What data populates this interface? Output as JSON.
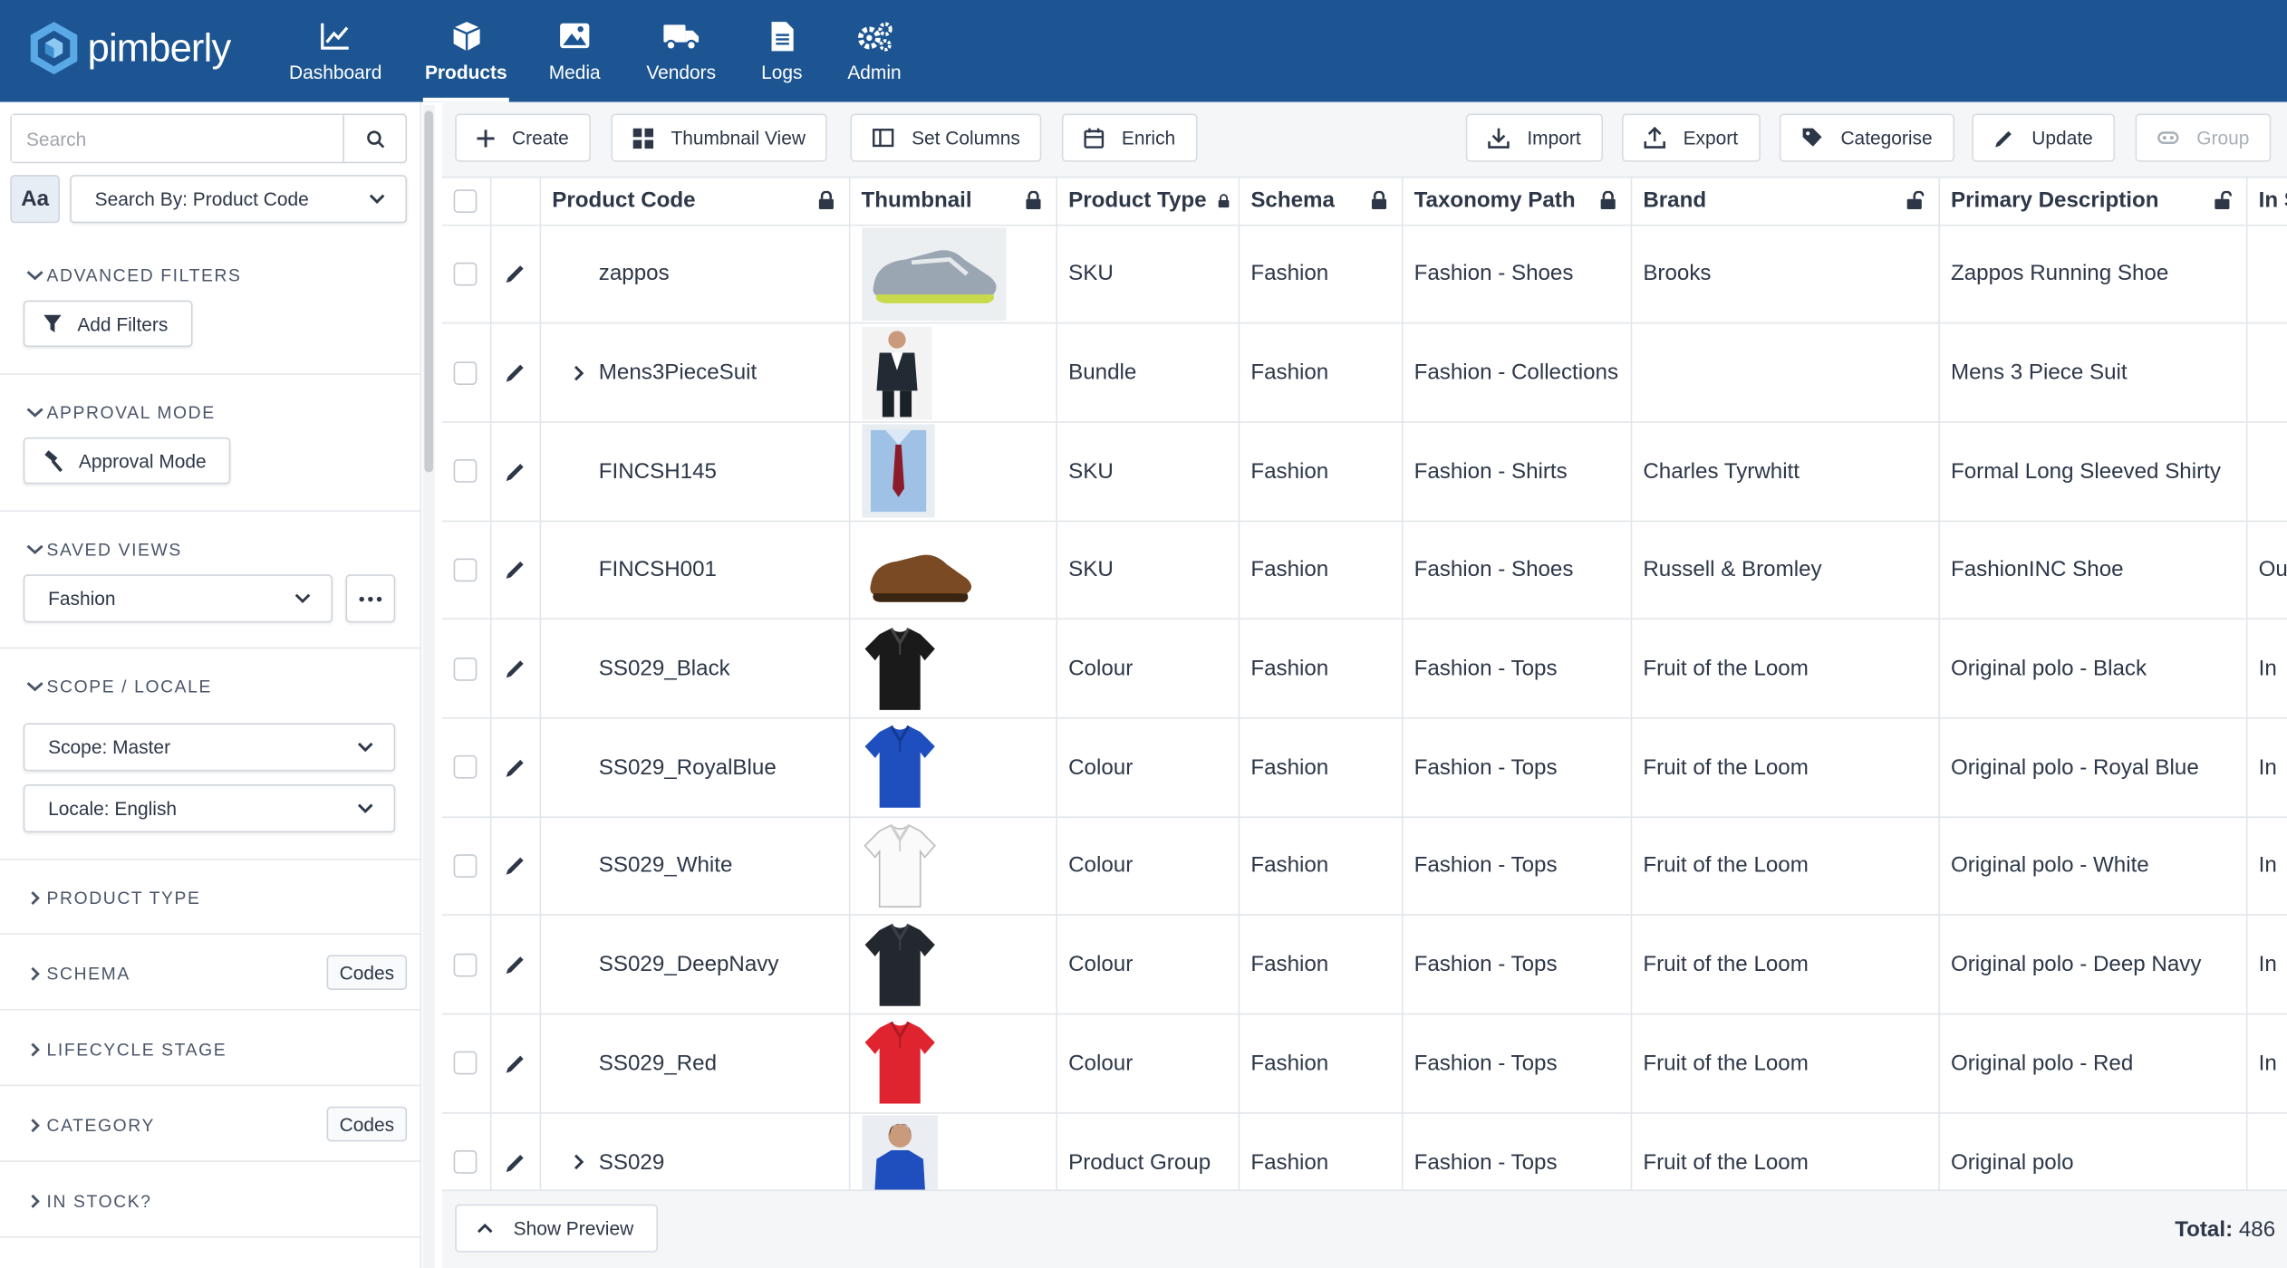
{
  "brand": {
    "name": "pimberly",
    "primary_color": "#1c5592"
  },
  "nav": [
    {
      "label": "Dashboard",
      "icon": "chart-line-icon",
      "active": false
    },
    {
      "label": "Products",
      "icon": "box-icon",
      "active": true
    },
    {
      "label": "Media",
      "icon": "image-icon",
      "active": false
    },
    {
      "label": "Vendors",
      "icon": "truck-icon",
      "active": false
    },
    {
      "label": "Logs",
      "icon": "file-icon",
      "active": false
    },
    {
      "label": "Admin",
      "icon": "gears-icon",
      "active": false
    }
  ],
  "sidebar": {
    "search_placeholder": "Search",
    "case_toggle": "Aa",
    "search_by": "Search By: Product Code",
    "advanced_filters": {
      "title": "ADVANCED FILTERS",
      "button": "Add Filters"
    },
    "approval_mode": {
      "title": "APPROVAL MODE",
      "button": "Approval Mode"
    },
    "saved_views": {
      "title": "SAVED VIEWS",
      "selected": "Fashion"
    },
    "scope_locale": {
      "title": "SCOPE / LOCALE",
      "scope": "Scope: Master",
      "locale": "Locale: English"
    },
    "collapsed_sections": [
      {
        "title": "PRODUCT TYPE",
        "codes": ""
      },
      {
        "title": "SCHEMA",
        "codes": "Codes"
      },
      {
        "title": "LIFECYCLE STAGE",
        "codes": ""
      },
      {
        "title": "CATEGORY",
        "codes": "Codes"
      },
      {
        "title": "IN STOCK?",
        "codes": ""
      }
    ]
  },
  "toolbar": {
    "left": [
      "Create",
      "Thumbnail View",
      "Set Columns",
      "Enrich"
    ],
    "right": [
      "Import",
      "Export",
      "Categorise",
      "Update",
      "Group"
    ]
  },
  "table": {
    "columns": [
      "Product Code",
      "Thumbnail",
      "Product Type",
      "Schema",
      "Taxonomy Path",
      "Brand",
      "Primary Description",
      "In S"
    ],
    "rows": [
      {
        "code": "zappos",
        "expandable": false,
        "thumb": "running-shoe",
        "type": "SKU",
        "schema": "Fashion",
        "taxonomy": "Fashion - Shoes",
        "brand": "Brooks",
        "description": "Zappos Running Shoe",
        "extra": ""
      },
      {
        "code": "Mens3PieceSuit",
        "expandable": true,
        "thumb": "suit",
        "type": "Bundle",
        "schema": "Fashion",
        "taxonomy": "Fashion - Collections",
        "brand": "",
        "description": "Mens 3 Piece Suit",
        "extra": ""
      },
      {
        "code": "FINCSH145",
        "expandable": false,
        "thumb": "shirt",
        "type": "SKU",
        "schema": "Fashion",
        "taxonomy": "Fashion - Shirts",
        "brand": "Charles Tyrwhitt",
        "description": "Formal Long Sleeved Shirty",
        "extra": ""
      },
      {
        "code": "FINCSH001",
        "expandable": false,
        "thumb": "brown-shoe",
        "type": "SKU",
        "schema": "Fashion",
        "taxonomy": "Fashion - Shoes",
        "brand": "Russell & Bromley",
        "description": "FashionINC Shoe",
        "extra": "Ou"
      },
      {
        "code": "SS029_Black",
        "expandable": false,
        "thumb": "polo-black",
        "type": "Colour",
        "schema": "Fashion",
        "taxonomy": "Fashion - Tops",
        "brand": "Fruit of the Loom",
        "description": "Original polo - Black",
        "extra": "In"
      },
      {
        "code": "SS029_RoyalBlue",
        "expandable": false,
        "thumb": "polo-blue",
        "type": "Colour",
        "schema": "Fashion",
        "taxonomy": "Fashion - Tops",
        "brand": "Fruit of the Loom",
        "description": "Original polo - Royal Blue",
        "extra": "In"
      },
      {
        "code": "SS029_White",
        "expandable": false,
        "thumb": "polo-white",
        "type": "Colour",
        "schema": "Fashion",
        "taxonomy": "Fashion - Tops",
        "brand": "Fruit of the Loom",
        "description": "Original polo - White",
        "extra": "In"
      },
      {
        "code": "SS029_DeepNavy",
        "expandable": false,
        "thumb": "polo-navy",
        "type": "Colour",
        "schema": "Fashion",
        "taxonomy": "Fashion - Tops",
        "brand": "Fruit of the Loom",
        "description": "Original polo - Deep Navy",
        "extra": "In"
      },
      {
        "code": "SS029_Red",
        "expandable": false,
        "thumb": "polo-red",
        "type": "Colour",
        "schema": "Fashion",
        "taxonomy": "Fashion - Tops",
        "brand": "Fruit of the Loom",
        "description": "Original polo - Red",
        "extra": "In"
      },
      {
        "code": "SS029",
        "expandable": true,
        "thumb": "polo-model",
        "type": "Product Group",
        "schema": "Fashion",
        "taxonomy": "Fashion - Tops",
        "brand": "Fruit of the Loom",
        "description": "Original polo",
        "extra": ""
      }
    ]
  },
  "footer": {
    "preview_button": "Show Preview",
    "total_label": "Total:",
    "total_value": "486"
  }
}
